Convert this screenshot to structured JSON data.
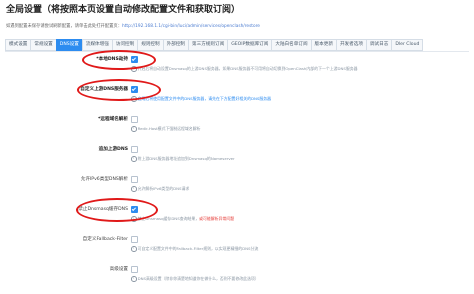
{
  "page": {
    "title": "全局设置（将按照本页设置自动修改配置文件和获取订阅）",
    "url_prefix": "如遇到配置未保存请尝试刷新配置，请单击此处打开配置页：",
    "url_link": "http://192.168.1.1/cgi-bin/luci/admin/services/openclash/restore"
  },
  "tabs": [
    {
      "label": "模式设置",
      "active": false
    },
    {
      "label": "常规设置",
      "active": false
    },
    {
      "label": "DNS设置",
      "active": true
    },
    {
      "label": "流媒体增强",
      "active": false
    },
    {
      "label": "访问控制",
      "active": false
    },
    {
      "label": "规则控制",
      "active": false
    },
    {
      "label": "外部控制",
      "active": false
    },
    {
      "label": "第三方规则订阅",
      "active": false
    },
    {
      "label": "GEOIP数据库订阅",
      "active": false
    },
    {
      "label": "大陆白名单订阅",
      "active": false
    },
    {
      "label": "版本更新",
      "active": false
    },
    {
      "label": "开发者选项",
      "active": false
    },
    {
      "label": "调试日志",
      "active": false
    },
    {
      "label": "Dler Cloud",
      "active": false
    }
  ],
  "settings": [
    {
      "label": "*本地DNS劫持",
      "required": true,
      "checked": true,
      "desc": "开启后将自动设置Dnsmasq的上游DNS服务器，如果DNS服务器不可用将自动切换到OpenClash内部的下一个上游DNS服务器"
    },
    {
      "label": "自定义上游DNS服务器",
      "required": false,
      "checked": true,
      "desc_blue": "启用后将使用配置文件中的DNS服务器，请先在下方配置好相关的DNS服务器"
    },
    {
      "label": "*远程域名解析",
      "required": true,
      "checked": false,
      "desc": "Redir-Host模式下强制远程域名解析"
    },
    {
      "label": "追加上游DNS",
      "required": false,
      "checked": false,
      "desc": "附上游DNS服务器地址追加到Dnsmasq的Nameserver"
    },
    {
      "label": "允许IPv6类型DNS解析",
      "required": false,
      "checked": false,
      "desc": "允许解析IPv6类型的DNS请求"
    },
    {
      "label": "禁止Dnsmasq缓存DNS",
      "required": false,
      "checked": true,
      "desc": "禁止Dnsmasq缓存DNS查询结果，",
      "desc_red": "或可能解析异常问题"
    },
    {
      "label": "自定义Fallback-Filter",
      "required": false,
      "checked": false,
      "desc": "可自定义配置文件中的Fallback-Filter规则，以实现更精细的DNS分流"
    },
    {
      "label": "高级设置",
      "required": false,
      "checked": false,
      "desc": "DNS高级设置（除非你清楚地知道你在做什么，否则不要修改此选项）"
    }
  ],
  "colors": {
    "accent": "#2d8cf0",
    "annotation_ring": "#e01919",
    "required_mark": "#e53935"
  }
}
